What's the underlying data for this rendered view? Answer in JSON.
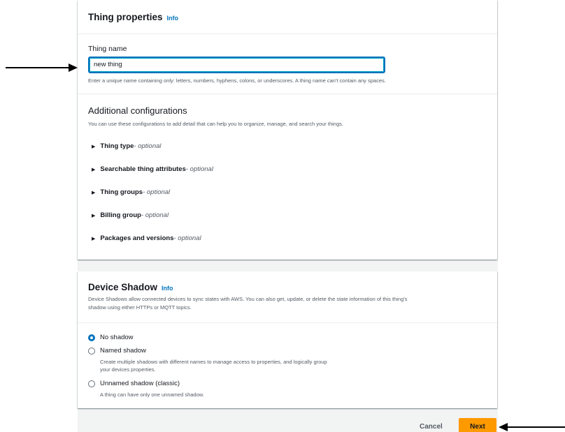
{
  "thing_properties": {
    "title": "Thing properties",
    "info": "Info",
    "name_label": "Thing name",
    "name_value": "new thing",
    "name_hint": "Enter a unique name containing only: letters, numbers, hyphens, colons, or underscores. A thing name can't contain any spaces."
  },
  "additional": {
    "title": "Additional configurations",
    "description": "You can use these configurations to add detail that can help you to organize, manage, and search your things.",
    "items": [
      {
        "label": "Thing type",
        "suffix": " - optional"
      },
      {
        "label": "Searchable thing attributes",
        "suffix": " - optional"
      },
      {
        "label": "Thing groups",
        "suffix": " - optional"
      },
      {
        "label": "Billing group",
        "suffix": " - optional"
      },
      {
        "label": "Packages and versions",
        "suffix": " - optional"
      }
    ]
  },
  "device_shadow": {
    "title": "Device Shadow",
    "info": "Info",
    "description_line1": "Device Shadows allow connected devices to sync states with AWS. You can also get, update, or delete the state information of this thing's",
    "description_line2": "shadow using either HTTPs or MQTT topics.",
    "options": [
      {
        "label": "No shadow",
        "selected": true
      },
      {
        "label": "Named shadow",
        "desc_line1": "Create multiple shadows with different names to manage access to properties, and logically group",
        "desc_line2": "your devices properties.",
        "selected": false
      },
      {
        "label": "Unnamed shadow (classic)",
        "desc_line1": "A thing can have only one unnamed shadow.",
        "selected": false
      }
    ]
  },
  "footer": {
    "cancel_label": "Cancel",
    "next_label": "Next"
  },
  "colors": {
    "accent": "#0073bb",
    "primary_button": "#ff9900"
  }
}
